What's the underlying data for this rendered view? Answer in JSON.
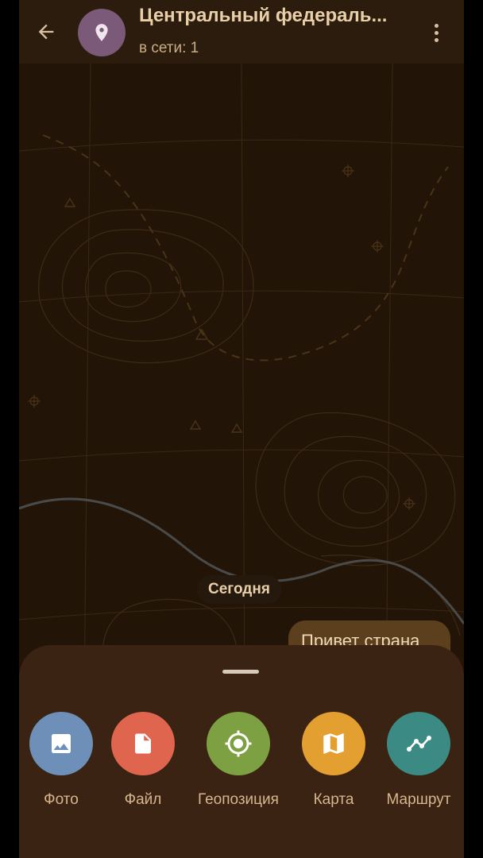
{
  "header": {
    "title": "Центральный федераль...",
    "status": "в сети: 1",
    "avatar_icon": "location-pin-icon",
    "back_icon": "arrow-back-icon",
    "menu_icon": "more-vert-icon"
  },
  "chat": {
    "date_separator": "Сегодня",
    "messages": [
      {
        "text": "Привет страна",
        "outgoing": true
      }
    ]
  },
  "attach_sheet": {
    "options": [
      {
        "label": "Фото",
        "icon": "image-icon",
        "color": "#6d8fb8"
      },
      {
        "label": "Файл",
        "icon": "file-icon",
        "color": "#e0654e"
      },
      {
        "label": "Геопозиция",
        "icon": "gps-location-icon",
        "color": "#7da043"
      },
      {
        "label": "Карта",
        "icon": "map-icon",
        "color": "#e3a031"
      },
      {
        "label": "Маршрут",
        "icon": "route-icon",
        "color": "#3b8a83"
      }
    ]
  },
  "colors": {
    "background": "#221508",
    "header": "#2c1c0d",
    "sheet": "#3a2312",
    "bubble": "#5c3f1d",
    "accent_text": "#e8cfa8"
  }
}
